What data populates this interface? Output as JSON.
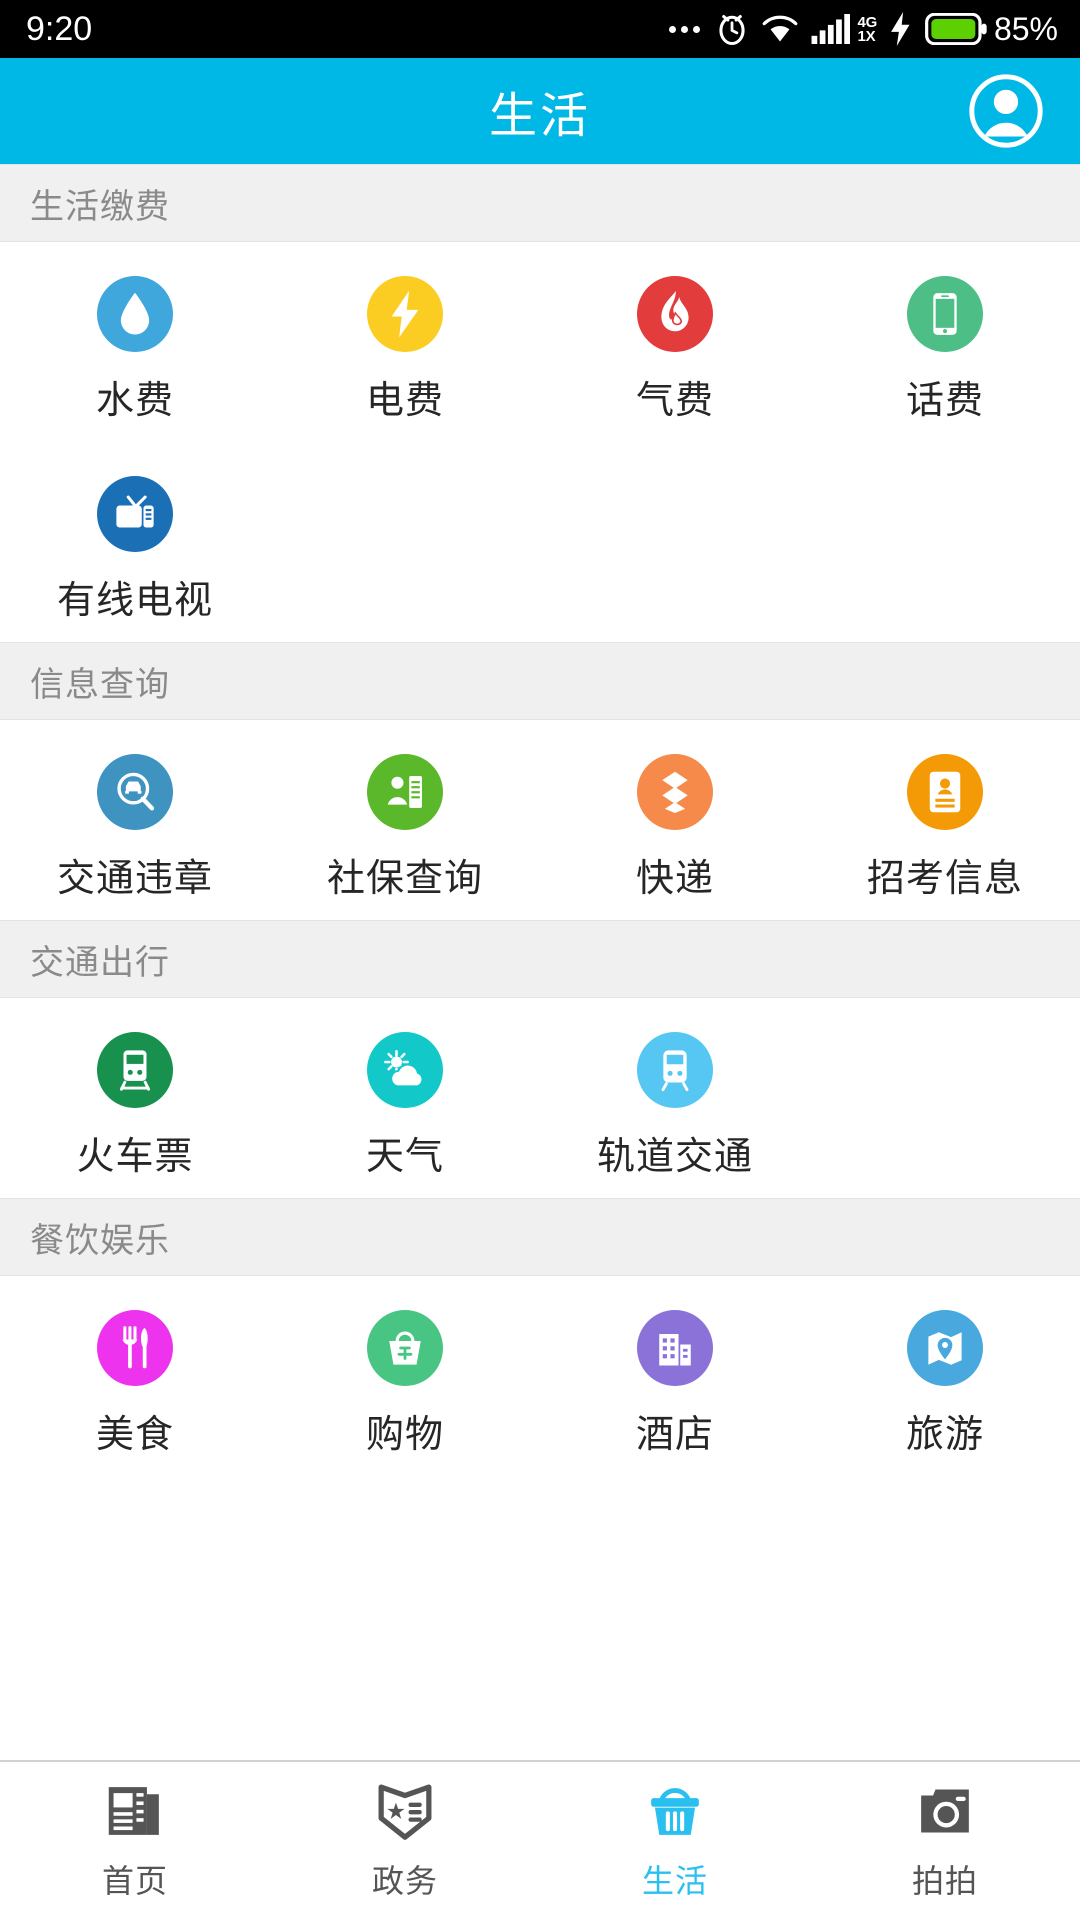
{
  "status_bar": {
    "time": "9:20",
    "network_type": "4G",
    "network_sub": "1X",
    "battery_percent": "85%",
    "icons": [
      "more-dots-icon",
      "alarm-clock-icon",
      "wifi-icon",
      "signal-bars-icon",
      "charging-bolt-icon",
      "battery-icon"
    ]
  },
  "header": {
    "title": "生活",
    "background": "#00b8e6",
    "avatar_icon": "user-avatar-icon"
  },
  "sections": [
    {
      "title": "生活缴费",
      "items": [
        {
          "label": "水费",
          "icon": "water-drop-icon",
          "color": "#3fa7dc"
        },
        {
          "label": "电费",
          "icon": "lightning-bolt-icon",
          "color": "#fbcd22"
        },
        {
          "label": "气费",
          "icon": "flame-icon",
          "color": "#e23c3c"
        },
        {
          "label": "话费",
          "icon": "smartphone-icon",
          "color": "#4cbe86"
        },
        {
          "label": "有线电视",
          "icon": "television-icon",
          "color": "#1b6fb5"
        }
      ]
    },
    {
      "title": "信息查询",
      "items": [
        {
          "label": "交通违章",
          "icon": "car-search-icon",
          "color": "#3e93c0"
        },
        {
          "label": "社保查询",
          "icon": "id-person-card-icon",
          "color": "#5cb82b"
        },
        {
          "label": "快递",
          "icon": "package-boxes-icon",
          "color": "#f58a4b"
        },
        {
          "label": "招考信息",
          "icon": "id-badge-icon",
          "color": "#f59a07"
        }
      ]
    },
    {
      "title": "交通出行",
      "items": [
        {
          "label": "火车票",
          "icon": "train-icon",
          "color": "#17914d"
        },
        {
          "label": "天气",
          "icon": "sun-cloud-icon",
          "color": "#12c8c8"
        },
        {
          "label": "轨道交通",
          "icon": "metro-tram-icon",
          "color": "#56c7f2"
        }
      ]
    },
    {
      "title": "餐饮娱乐",
      "items": [
        {
          "label": "美食",
          "icon": "fork-knife-icon",
          "color": "#ee33ee"
        },
        {
          "label": "购物",
          "icon": "shopping-bag-icon",
          "color": "#49c583"
        },
        {
          "label": "酒店",
          "icon": "hotel-building-icon",
          "color": "#8b72d8"
        },
        {
          "label": "旅游",
          "icon": "map-pin-icon",
          "color": "#49a8dd"
        }
      ]
    }
  ],
  "tabbar": {
    "active_color": "#29c0f0",
    "inactive_color": "#555555",
    "tabs": [
      {
        "label": "首页",
        "icon": "newspaper-icon",
        "active": false
      },
      {
        "label": "政务",
        "icon": "shield-badge-icon",
        "active": false
      },
      {
        "label": "生活",
        "icon": "basket-icon",
        "active": true
      },
      {
        "label": "拍拍",
        "icon": "camera-icon",
        "active": false
      }
    ]
  }
}
